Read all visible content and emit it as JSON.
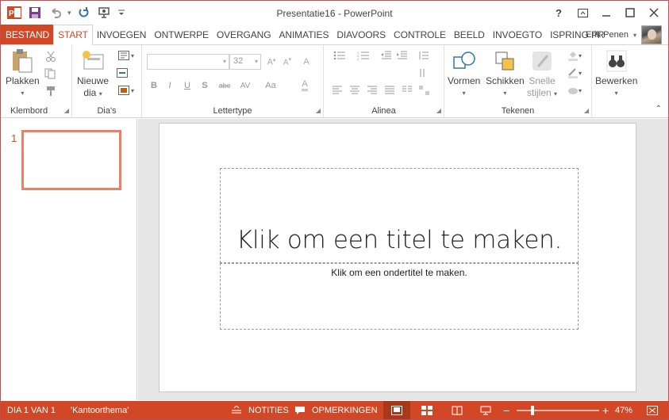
{
  "window": {
    "title": "Presentatie16 - PowerPoint",
    "controls": [
      "?",
      "minimize",
      "restore",
      "close"
    ]
  },
  "quick_access": [
    "powerpoint-logo-icon",
    "save-icon",
    "undo-icon",
    "redo-icon",
    "start-slideshow-icon",
    "customize-icon"
  ],
  "tabs": [
    {
      "label": "BESTAND"
    },
    {
      "label": "START"
    },
    {
      "label": "INVOEGEN"
    },
    {
      "label": "ONTWERPE"
    },
    {
      "label": "OVERGANG"
    },
    {
      "label": "ANIMATIES"
    },
    {
      "label": "DIAVOORS"
    },
    {
      "label": "CONTROLE"
    },
    {
      "label": "BEELD"
    },
    {
      "label": "INVOEGTO"
    },
    {
      "label": "ISPRING PR"
    }
  ],
  "user": {
    "name": "Erik Penen"
  },
  "ribbon": {
    "clipboard": {
      "label": "Klembord",
      "paste": "Plakken"
    },
    "slides": {
      "label": "Dia's",
      "new_slide_1": "Nieuwe",
      "new_slide_2": "dia"
    },
    "font": {
      "label": "Lettertype",
      "font_size": "32",
      "buttons": [
        "B",
        "I",
        "U",
        "S",
        "abc",
        "AV",
        "Aa"
      ]
    },
    "paragraph": {
      "label": "Alinea"
    },
    "drawing": {
      "label": "Tekenen",
      "shapes": "Vormen",
      "arrange": "Schikken",
      "quick_styles_1": "Snelle",
      "quick_styles_2": "stijlen"
    },
    "editing": {
      "label": "Bewerken"
    }
  },
  "thumbnails": [
    {
      "number": "1"
    }
  ],
  "slide": {
    "title_placeholder": "Klik om een titel te maken.",
    "subtitle_placeholder": "Klik om een ondertitel te maken."
  },
  "status": {
    "slide_info": "DIA 1 VAN 1",
    "theme": "'Kantoorthema'",
    "notes": "NOTITIES",
    "comments": "OPMERKINGEN",
    "zoom": "47%"
  },
  "colors": {
    "accent": "#d24726",
    "thumbnail_border": "#e9806a"
  }
}
